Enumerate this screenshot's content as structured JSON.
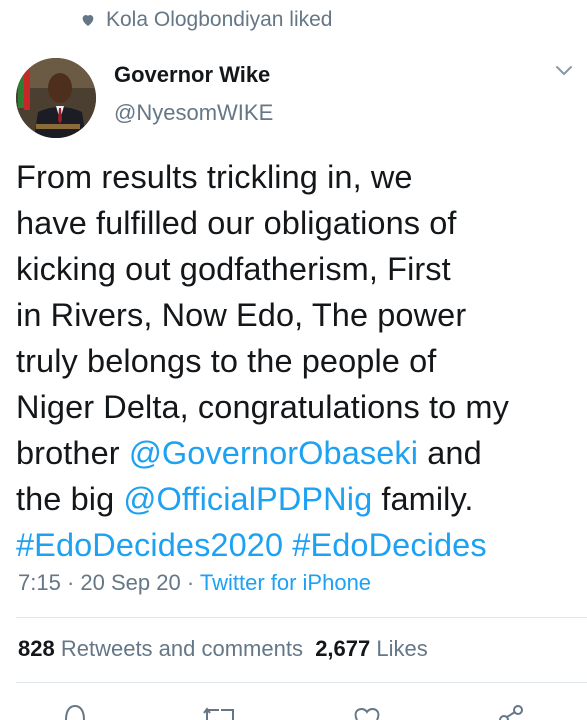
{
  "social_context": {
    "text": "Kola Ologbondiyan liked",
    "icon": "heart-icon"
  },
  "author": {
    "name": "Governor Wike",
    "handle": "@NyesomWIKE"
  },
  "tweet": {
    "l1": "From results trickling in, we",
    "l2": "have fulfilled our obligations of",
    "l3": "kicking out godfatherism, First",
    "l4": "in Rivers, Now Edo, The power",
    "l5": "truly belongs to the people of",
    "l6": "Niger Delta, congratulations to my",
    "l7_pre": "brother ",
    "l7_mention": "@GovernorObaseki",
    "l7_post": " and",
    "l8_pre": "the big ",
    "l8_mention": "@OfficialPDPNig",
    "l8_post": " family.",
    "hashtag1": "#EdoDecides2020",
    "hashtag2": "#EdoDecides"
  },
  "meta": {
    "time": "7:15",
    "sep1": " · ",
    "date": "20 Sep 20",
    "sep2": " · ",
    "source": "Twitter for iPhone"
  },
  "stats": {
    "retweets_count": "828",
    "retweets_label": "Retweets and comments",
    "likes_count": "2,677",
    "likes_label": "Likes"
  },
  "colors": {
    "link": "#1da1f2",
    "secondary": "#657786",
    "text": "#14171a",
    "divider": "#e1e8ed"
  },
  "actions": [
    "reply-icon",
    "retweet-icon",
    "like-icon",
    "share-icon"
  ]
}
